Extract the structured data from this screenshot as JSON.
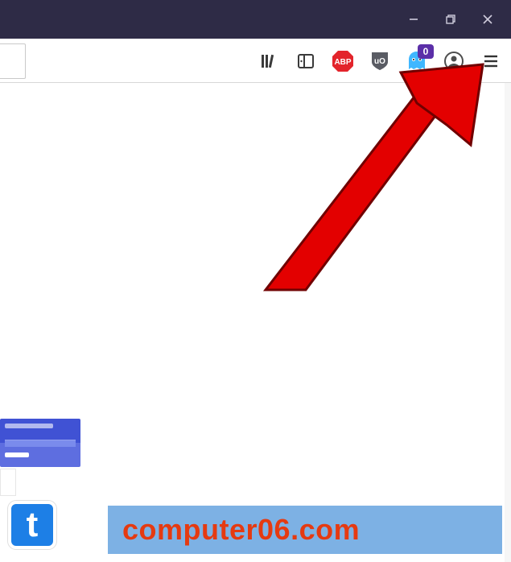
{
  "window": {
    "controls": {
      "minimize": "minimize",
      "maximize": "restore",
      "close": "close"
    }
  },
  "toolbar": {
    "icons": {
      "library": "library-icon",
      "sidebar": "sidebar-icon",
      "abp": "ABP",
      "ublock": "uO",
      "ghostery": "ghostery-icon",
      "ghostery_badge": "0",
      "account": "account-icon",
      "menu": "menu-icon"
    }
  },
  "annotation": {
    "arrow_target": "menu-icon"
  },
  "thumbs": {
    "tile_letter": "t"
  },
  "watermark": {
    "text": "computer06.com"
  }
}
